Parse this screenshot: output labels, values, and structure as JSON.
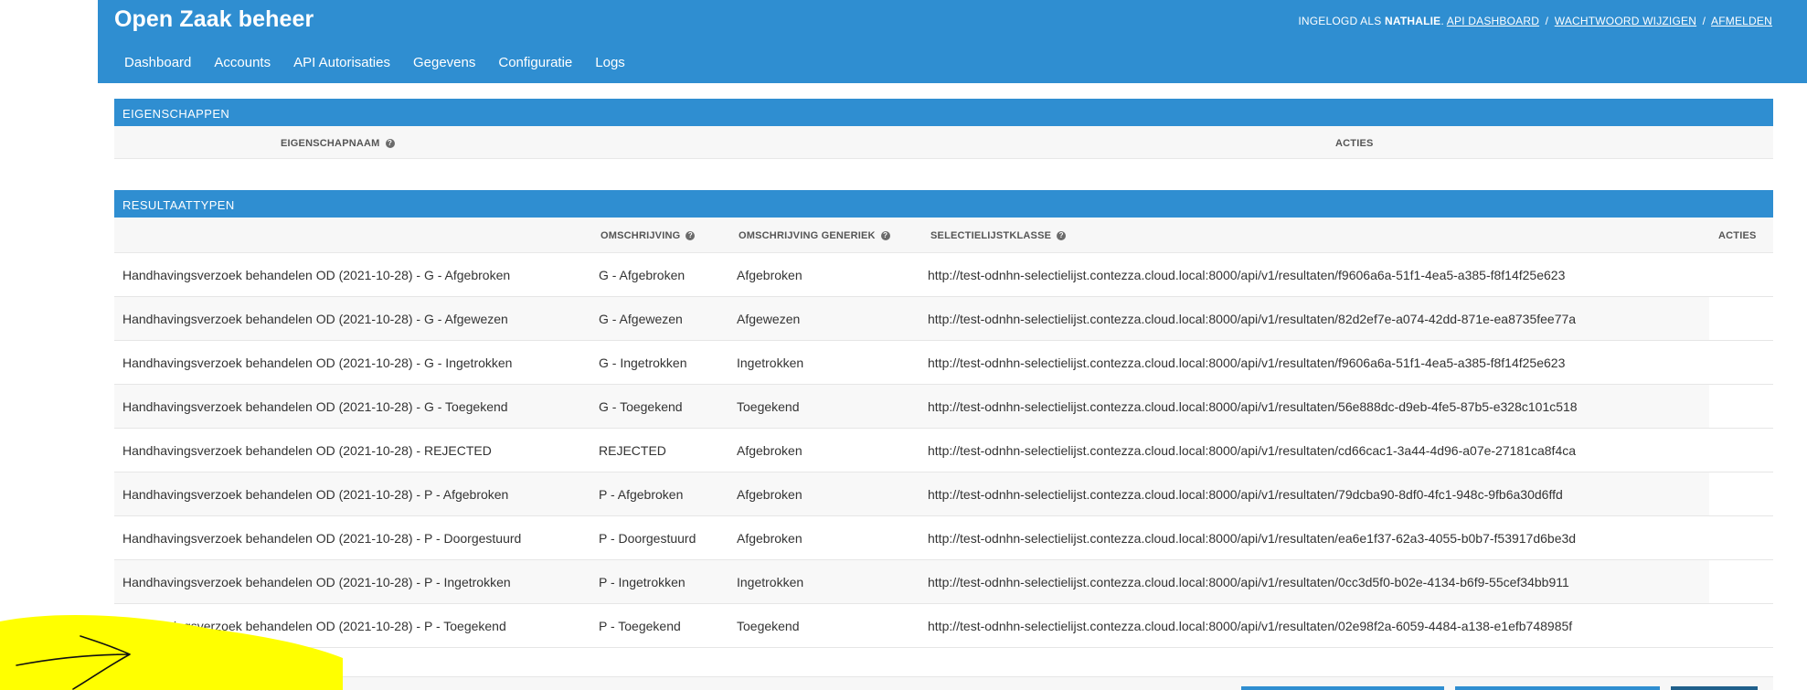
{
  "header": {
    "title": "Open Zaak beheer",
    "user_prefix": "INGELOGD ALS",
    "username": "NATHALIE",
    "links": [
      "API DASHBOARD",
      "WACHTWOORD WIJZIGEN",
      "AFMELDEN"
    ],
    "separator": "/"
  },
  "nav": [
    "Dashboard",
    "Accounts",
    "API Autorisaties",
    "Gegevens",
    "Configuratie",
    "Logs"
  ],
  "eigenschappen": {
    "caption": "EIGENSCHAPPEN",
    "col_name": "EIGENSCHAPNAAM",
    "col_acties": "ACTIES"
  },
  "resultaattypen": {
    "caption": "RESULTAATTYPEN",
    "columns": {
      "omschrijving": "OMSCHRIJVING",
      "generiek": "OMSCHRIJVING GENERIEK",
      "selectielijst": "SELECTIELIJSTKLASSE",
      "acties": "ACTIES"
    },
    "rows": [
      {
        "name": "Handhavingsverzoek behandelen OD (2021-10-28) - G - Afgebroken",
        "oms": "G - Afgebroken",
        "gen": "Afgebroken",
        "url": "http://test-odnhn-selectielijst.contezza.cloud.local:8000/api/v1/resultaten/f9606a6a-51f1-4ea5-a385-f8f14f25e623"
      },
      {
        "name": "Handhavingsverzoek behandelen OD (2021-10-28) - G - Afgewezen",
        "oms": "G - Afgewezen",
        "gen": "Afgewezen",
        "url": "http://test-odnhn-selectielijst.contezza.cloud.local:8000/api/v1/resultaten/82d2ef7e-a074-42dd-871e-ea8735fee77a"
      },
      {
        "name": "Handhavingsverzoek behandelen OD (2021-10-28) - G - Ingetrokken",
        "oms": "G - Ingetrokken",
        "gen": "Ingetrokken",
        "url": "http://test-odnhn-selectielijst.contezza.cloud.local:8000/api/v1/resultaten/f9606a6a-51f1-4ea5-a385-f8f14f25e623"
      },
      {
        "name": "Handhavingsverzoek behandelen OD (2021-10-28) - G - Toegekend",
        "oms": "G - Toegekend",
        "gen": "Toegekend",
        "url": "http://test-odnhn-selectielijst.contezza.cloud.local:8000/api/v1/resultaten/56e888dc-d9eb-4fe5-87b5-e328c101c518"
      },
      {
        "name": "Handhavingsverzoek behandelen OD (2021-10-28) - REJECTED",
        "oms": "REJECTED",
        "gen": "Afgebroken",
        "url": "http://test-odnhn-selectielijst.contezza.cloud.local:8000/api/v1/resultaten/cd66cac1-3a44-4d96-a07e-27181ca8f4ca"
      },
      {
        "name": "Handhavingsverzoek behandelen OD (2021-10-28) - P - Afgebroken",
        "oms": "P - Afgebroken",
        "gen": "Afgebroken",
        "url": "http://test-odnhn-selectielijst.contezza.cloud.local:8000/api/v1/resultaten/79dcba90-8df0-4fc1-948c-9fb6a30d6ffd"
      },
      {
        "name": "Handhavingsverzoek behandelen OD (2021-10-28) - P - Doorgestuurd",
        "oms": "P - Doorgestuurd",
        "gen": "Afgebroken",
        "url": "http://test-odnhn-selectielijst.contezza.cloud.local:8000/api/v1/resultaten/ea6e1f37-62a3-4055-b0b7-f53917d6be3d"
      },
      {
        "name": "Handhavingsverzoek behandelen OD (2021-10-28) - P - Ingetrokken",
        "oms": "P - Ingetrokken",
        "gen": "Ingetrokken",
        "url": "http://test-odnhn-selectielijst.contezza.cloud.local:8000/api/v1/resultaten/0cc3d5f0-b02e-4134-b6f9-55cef34bb911"
      },
      {
        "name": "Handhavingsverzoek behandelen OD (2021-10-28) - P - Toegekend",
        "oms": "P - Toegekend",
        "gen": "Toegekend",
        "url": "http://test-odnhn-selectielijst.contezza.cloud.local:8000/api/v1/resultaten/02e98f2a-6059-4484-a138-e1efb748985f"
      }
    ]
  },
  "colors": {
    "primary": "#2f8ed1",
    "highlight": "#ffff00",
    "row_alt": "#f8f8f8"
  }
}
